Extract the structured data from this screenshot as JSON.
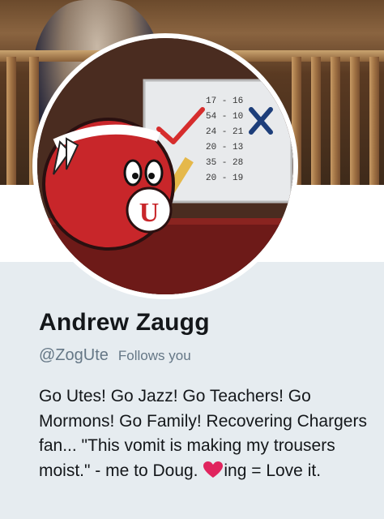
{
  "profile": {
    "name": "Andrew Zaugg",
    "handle": "@ZogUte",
    "follows_you": "Follows you",
    "bio": {
      "part1": "Go Utes! Go Jazz! Go Teachers! Go Mormons! Go Family! Recovering Chargers fan... \"This vomit is making my trousers moist.\" - me to Doug. ",
      "heart_icon": "red-heart-icon",
      "part2": "ing = Love it."
    }
  },
  "avatar": {
    "scores": [
      "17 - 16",
      "54 - 10",
      "24 - 21",
      "20 - 13",
      "35 - 28",
      "20 - 19"
    ],
    "mascot_letter": "U"
  },
  "colors": {
    "background": "#e6ecf0",
    "name_text": "#14171a",
    "secondary_text": "#657786",
    "heart": "#e0245e",
    "mascot_red": "#c8262a",
    "check_red": "#d62d2d",
    "cross_blue": "#1d3e7a"
  }
}
